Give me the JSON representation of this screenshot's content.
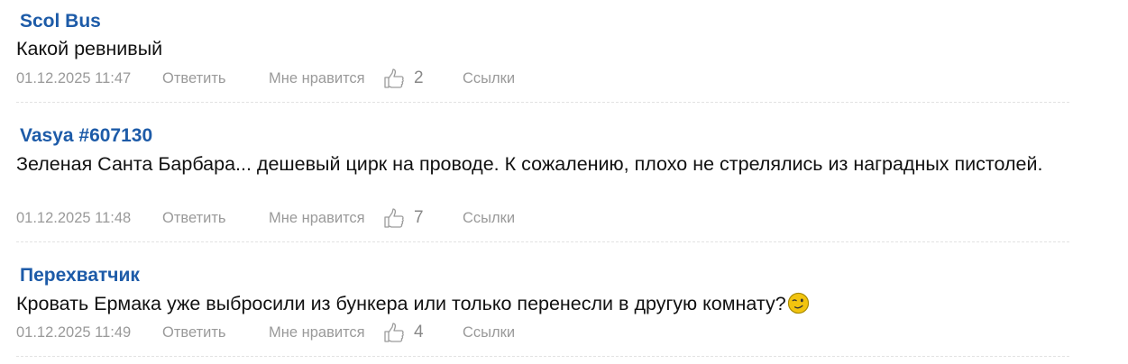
{
  "comments": [
    {
      "author": "Scol Bus",
      "text": "Какой ревнивый",
      "date": "01.12.2025 11:47",
      "reply_label": "Ответить",
      "like_label": "Мне нравится",
      "likes": "2",
      "links_label": "Ссылки"
    },
    {
      "author": "Vasya #607130",
      "text": "Зеленая Санта Барбара... дешевый цирк на проводе. К сожалению, плохо не стрелялись из наградных пистолей.",
      "date": "01.12.2025 11:48",
      "reply_label": "Ответить",
      "like_label": "Мне нравится",
      "likes": "7",
      "links_label": "Ссылки"
    },
    {
      "author": "Перехватчик",
      "text": "Кровать Ермака уже выбросили из бункера или только перенесли в другую комнату?",
      "emoji": "wink-smiley-icon",
      "date": "01.12.2025 11:49",
      "reply_label": "Ответить",
      "like_label": "Мне нравится",
      "likes": "4",
      "links_label": "Ссылки"
    }
  ],
  "colors": {
    "author": "#1d5ba8",
    "text": "#111111",
    "meta": "#9a9a9a",
    "divider": "#e2e2e2",
    "smiley": "#f2c40f"
  }
}
